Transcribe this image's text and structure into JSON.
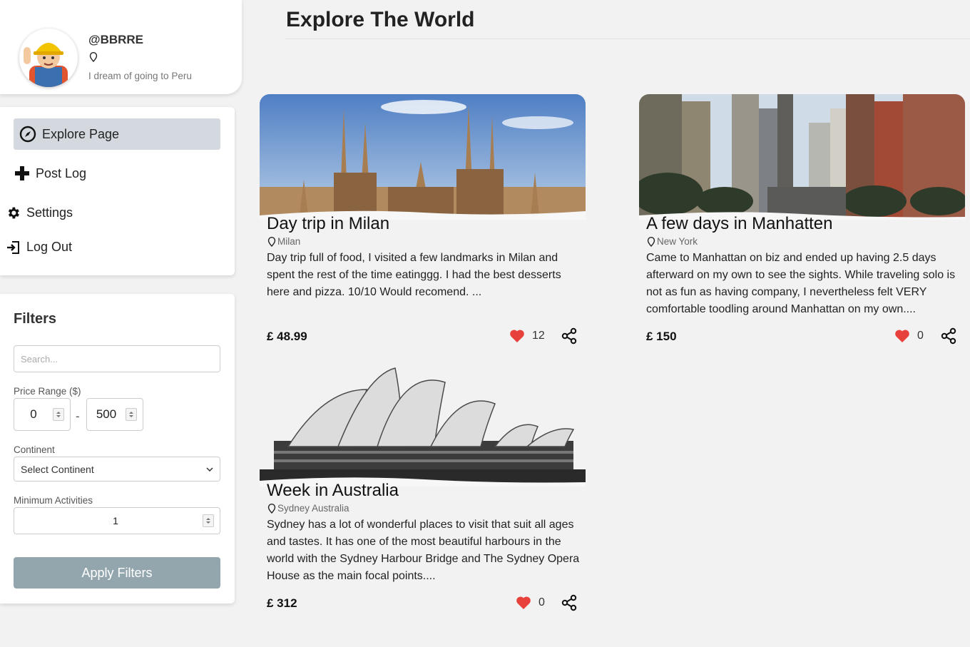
{
  "profile": {
    "username": "@BBRRE",
    "location": "",
    "bio": "I dream of going to Peru"
  },
  "nav": {
    "items": [
      {
        "label": "Explore Page",
        "icon": "compass-icon",
        "active": true
      },
      {
        "label": "Post Log",
        "icon": "plus-icon"
      },
      {
        "label": "Settings",
        "icon": "gear-icon"
      },
      {
        "label": "Log Out",
        "icon": "logout-icon"
      }
    ]
  },
  "filters": {
    "title": "Filters",
    "search_placeholder": "Search...",
    "price_label": "Price Range ($)",
    "price_min": "0",
    "price_max": "500",
    "price_separator": "-",
    "continent_label": "Continent",
    "continent_value": "Select Continent",
    "min_activities_label": "Minimum Activities",
    "min_activities_value": "1",
    "apply_label": "Apply Filters"
  },
  "page": {
    "title": "Explore The World"
  },
  "posts": [
    {
      "title": "Day trip in Milan",
      "location": "Milan",
      "description": "Day trip full of food, I visited a few landmarks in Milan and spent the rest of the time eatinggg. I had the best desserts here and pizza. 10/10 Would recomend. ...",
      "price": "£ 48.99",
      "likes": "12",
      "image": "milan-cathedral"
    },
    {
      "title": "A few days in Manhatten",
      "location": "New York",
      "description": "Came to Manhattan on biz and ended up having 2.5 days afterward on my own to see the sights. While traveling solo is not as fun as having company, I nevertheless felt VERY comfortable toodling around Manhattan on my own....",
      "price": "£ 150",
      "likes": "0",
      "image": "manhattan-street"
    },
    {
      "title": "Week in Australia",
      "location": "Sydney Australia",
      "description": "Sydney has a lot of wonderful places to visit that suit all ages and tastes. It has one of the most beautiful harbours in the world with the Sydney Harbour Bridge and The Sydney Opera House as the main focal points....",
      "price": "£ 312",
      "likes": "0",
      "image": "sydney-opera-house"
    }
  ],
  "colors": {
    "heart": "#e8413c",
    "active_nav": "#d3d9de",
    "apply_button": "#93a6ae"
  }
}
